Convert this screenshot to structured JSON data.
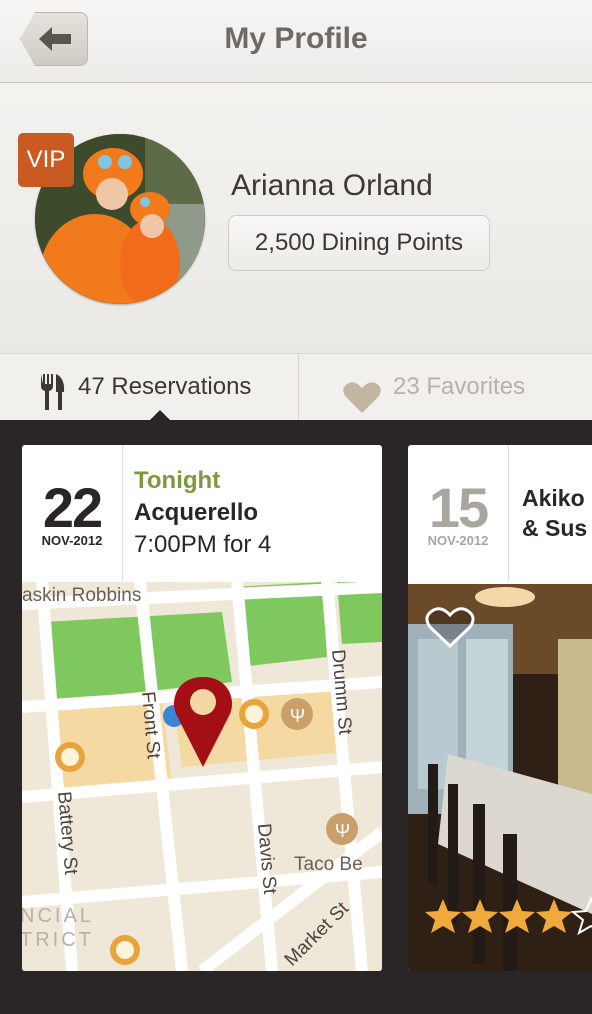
{
  "header": {
    "title": "My Profile",
    "back_icon": "back-arrow-icon"
  },
  "profile": {
    "badge": "VIP",
    "name": "Arianna Orland",
    "points": "2,500 Dining Points"
  },
  "tabs": [
    {
      "label": "47 Reservations",
      "icon": "fork-knife-icon",
      "active": true
    },
    {
      "label": "23 Favorites",
      "icon": "heart-icon",
      "active": false
    }
  ],
  "reservations": [
    {
      "day": "22",
      "month": "NOV-2012",
      "when": "Tonight",
      "restaurant": "Acquerello",
      "time": "7:00PM for 4",
      "map_labels": {
        "poi_top": "askin Robbins",
        "street_front": "Front St",
        "street_drumm": "Drumm St",
        "street_battery": "Battery St",
        "street_davis": "Davis St",
        "street_market": "Market St",
        "poi_taco": "Taco Be",
        "district_1": "NCIAL",
        "district_2": "TRICT"
      }
    },
    {
      "day": "15",
      "month": "NOV-2012",
      "restaurant_line1": "Akiko",
      "restaurant_line2": "& Sus",
      "rating": 4
    }
  ],
  "colors": {
    "accent_green": "#7d9a3a",
    "vip_orange": "#c85a22",
    "pin_red": "#a30f14"
  }
}
